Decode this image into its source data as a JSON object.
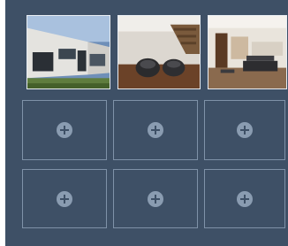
{
  "gallery": {
    "photos": [
      {
        "icon": "exterior-house-photo"
      },
      {
        "icon": "living-room-staircase-photo"
      },
      {
        "icon": "open-living-room-photo"
      }
    ],
    "empty_slots": [
      {
        "icon": "add-icon"
      },
      {
        "icon": "add-icon"
      },
      {
        "icon": "add-icon"
      },
      {
        "icon": "add-icon"
      },
      {
        "icon": "add-icon"
      },
      {
        "icon": "add-icon"
      }
    ],
    "colors": {
      "panel_background": "#3e5066",
      "slot_border": "#7f92a8",
      "add_icon": "#8a9cb1"
    }
  }
}
